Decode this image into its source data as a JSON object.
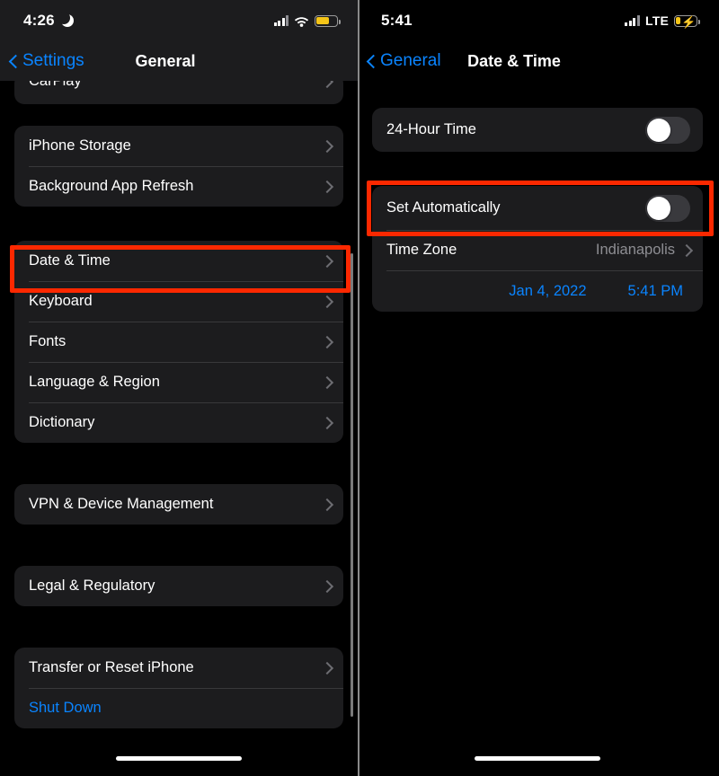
{
  "colors": {
    "highlight": "#fc2800",
    "accent_blue": "#0a84ff",
    "group_bg": "#1c1c1e",
    "secondary_text": "#8e8e93",
    "battery_yellow": "#f5c518"
  },
  "left_phone": {
    "status_bar": {
      "time": "4:26",
      "dnd_icon": "moon-icon",
      "signal_icon": "cellular-signal-icon",
      "wifi_icon": "wifi-icon",
      "battery_icon": "battery-low-power-icon"
    },
    "nav": {
      "back_label": "Settings",
      "back_icon": "chevron-left-icon",
      "title": "General"
    },
    "clipped_row": {
      "label": "CarPlay",
      "chevron": "chevron-right-icon"
    },
    "groups": [
      {
        "rows": [
          {
            "label": "iPhone Storage",
            "chevron": "chevron-right-icon"
          },
          {
            "label": "Background App Refresh",
            "chevron": "chevron-right-icon"
          }
        ]
      },
      {
        "rows": [
          {
            "label": "Date & Time",
            "chevron": "chevron-right-icon",
            "highlighted": true
          },
          {
            "label": "Keyboard",
            "chevron": "chevron-right-icon"
          },
          {
            "label": "Fonts",
            "chevron": "chevron-right-icon"
          },
          {
            "label": "Language & Region",
            "chevron": "chevron-right-icon"
          },
          {
            "label": "Dictionary",
            "chevron": "chevron-right-icon"
          }
        ]
      },
      {
        "rows": [
          {
            "label": "VPN & Device Management",
            "chevron": "chevron-right-icon"
          }
        ]
      },
      {
        "rows": [
          {
            "label": "Legal & Regulatory",
            "chevron": "chevron-right-icon"
          }
        ]
      },
      {
        "rows": [
          {
            "label": "Transfer or Reset iPhone",
            "chevron": "chevron-right-icon"
          },
          {
            "label": "Shut Down",
            "style": "blue"
          }
        ]
      }
    ]
  },
  "right_phone": {
    "status_bar": {
      "time": "5:41",
      "signal_icon": "cellular-signal-icon",
      "network_label": "LTE",
      "battery_icon": "battery-charging-icon"
    },
    "nav": {
      "back_label": "General",
      "back_icon": "chevron-left-icon",
      "title": "Date & Time"
    },
    "groups": [
      {
        "rows": [
          {
            "label": "24-Hour Time",
            "control": "toggle",
            "value": "off"
          }
        ]
      },
      {
        "rows": [
          {
            "label": "Set Automatically",
            "control": "toggle",
            "value": "off",
            "highlighted": true
          },
          {
            "label": "Time Zone",
            "value": "Indianapolis",
            "chevron": "chevron-right-icon"
          }
        ],
        "datetime_row": {
          "date": "Jan 4, 2022",
          "time": "5:41 PM"
        }
      }
    ]
  }
}
